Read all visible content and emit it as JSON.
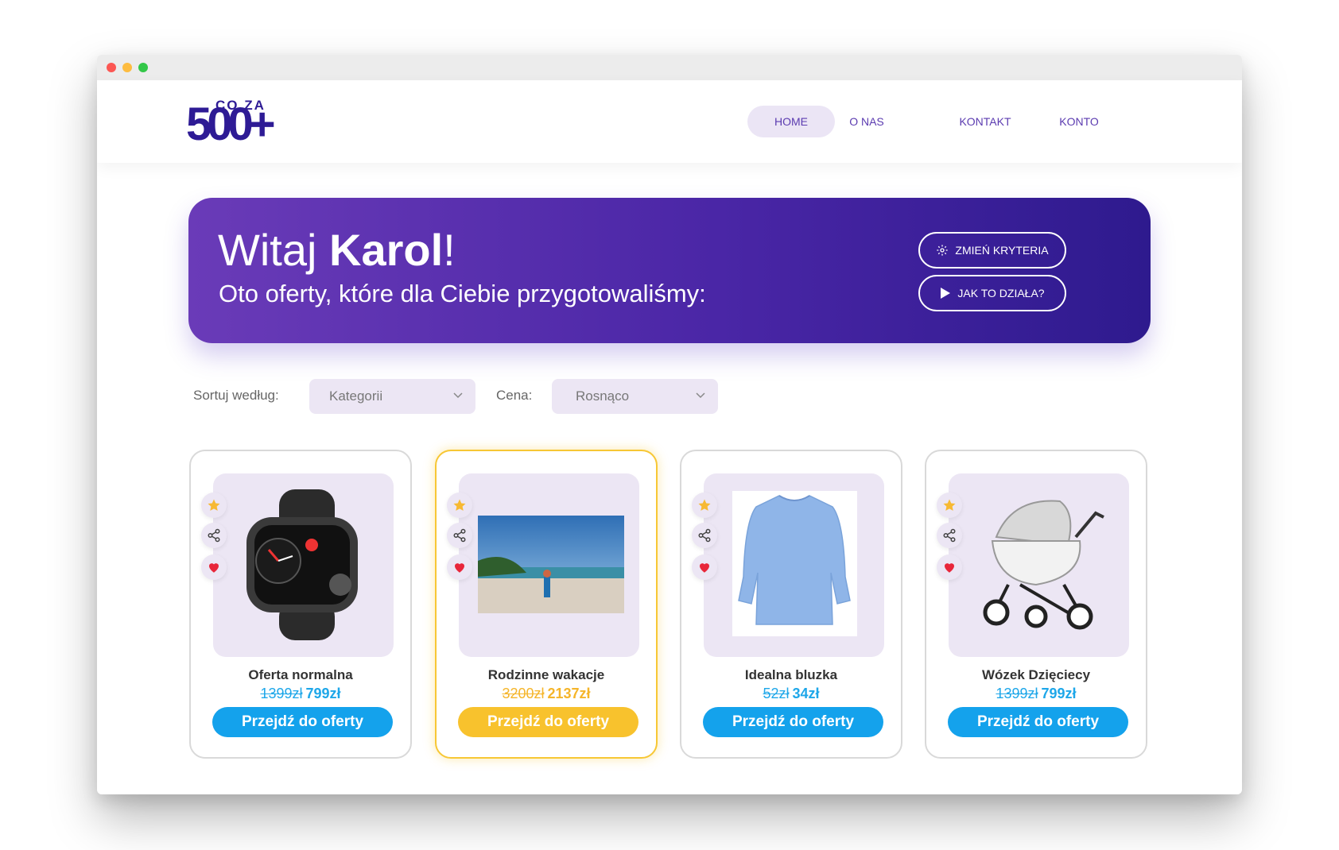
{
  "brand": {
    "small": "CO ZA",
    "big": "500+"
  },
  "nav": [
    {
      "label": "HOME",
      "active": true
    },
    {
      "label": "O NAS",
      "active": false
    },
    {
      "label": "KONTAKT",
      "active": false
    },
    {
      "label": "KONTO",
      "active": false
    }
  ],
  "hero": {
    "greet_prefix": "Witaj ",
    "name": "Karol",
    "greet_suffix": "!",
    "subtitle": "Oto oferty, które dla Ciebie przygotowaliśmy:",
    "btn_criteria": "ZMIEŃ KRYTERIA",
    "btn_how": "JAK TO DZIAŁA?"
  },
  "filters": {
    "sort_label": "Sortuj według:",
    "sort_value": "Kategorii",
    "price_label": "Cena:",
    "price_value": "Rosnąco"
  },
  "offers": [
    {
      "title": "Oferta normalna",
      "old_price": "1399zł",
      "new_price": "799zł",
      "cta": "Przejdź do oferty",
      "image": "smartwatch"
    },
    {
      "title": "Rodzinne wakacje",
      "old_price": "3200zł",
      "new_price": "2137zł",
      "cta": "Przejdź do oferty",
      "image": "beach"
    },
    {
      "title": "Idealna bluzka",
      "old_price": "52zł",
      "new_price": "34zł",
      "cta": "Przejdź do oferty",
      "image": "blouse"
    },
    {
      "title": "Wózek Dzięciecy",
      "old_price": "1399zł",
      "new_price": "799zł",
      "cta": "Przejdź do oferty",
      "image": "stroller"
    }
  ],
  "colors": {
    "brand": "#2e1b95",
    "accent_blue": "#14a2ec",
    "accent_yellow": "#f8c22d",
    "card_bg": "#ece6f4"
  },
  "icons": [
    "star-icon",
    "share-icon",
    "heart-icon",
    "gear-icon",
    "play-icon",
    "chevron-down-icon"
  ]
}
